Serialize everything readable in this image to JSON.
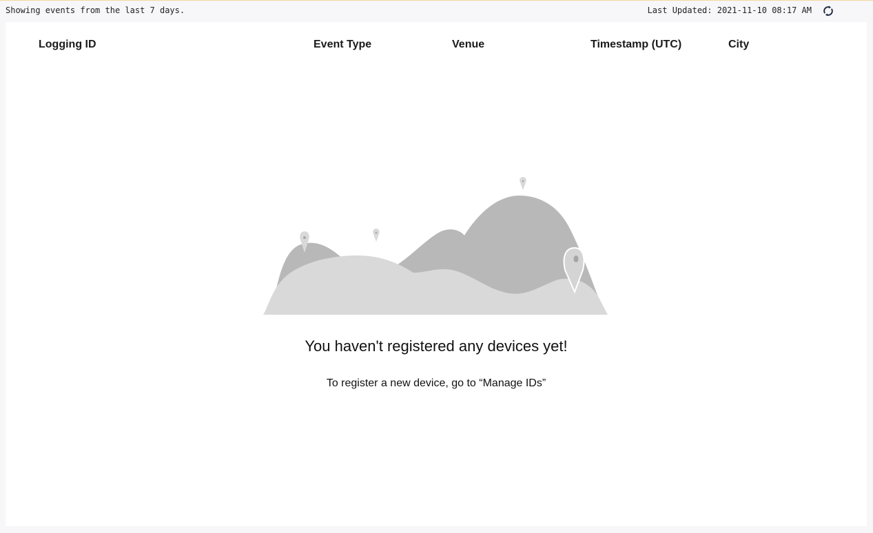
{
  "status_bar": {
    "range_text": "Showing events from the last 7 days.",
    "last_updated_text": "Last Updated: 2021-11-10 08:17 AM",
    "refresh_icon": "refresh-icon"
  },
  "table": {
    "columns": [
      "Logging ID",
      "Event Type",
      "Venue",
      "Timestamp (UTC)",
      "City"
    ]
  },
  "empty_state": {
    "illustration_icon": "mountains-with-location-pins-icon",
    "title": "You haven't registered any devices yet!",
    "subtitle": "To register a new device, go to “Manage IDs”"
  },
  "colors": {
    "background": "#f7f6f8",
    "panel": "#ffffff",
    "hill_dark": "#b8b8b8",
    "hill_light": "#d9d9d9",
    "refresh_icon": "#1f2a44"
  }
}
